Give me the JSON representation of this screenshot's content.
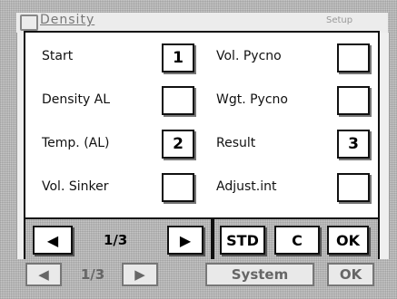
{
  "background": {
    "title": "Density",
    "corner_label": "Setup",
    "footer": {
      "page": "1/3",
      "system_label": "System",
      "ok_label": "OK"
    }
  },
  "dialog": {
    "left_options": [
      {
        "label": "Start",
        "value": "1"
      },
      {
        "label": "Density  AL",
        "value": ""
      },
      {
        "label": "Temp. (AL)",
        "value": "2"
      },
      {
        "label": "Vol. Sinker",
        "value": ""
      }
    ],
    "right_options": [
      {
        "label": "Vol. Pycno",
        "value": ""
      },
      {
        "label": "Wgt. Pycno",
        "value": ""
      },
      {
        "label": "Result",
        "value": "3"
      },
      {
        "label": "Adjust.int",
        "value": ""
      }
    ],
    "page_indicator": "1/3",
    "std_label": "STD",
    "c_label": "C",
    "ok_label": "OK"
  },
  "icons": {
    "prev": "left-triangle-icon",
    "next": "right-triangle-icon"
  }
}
